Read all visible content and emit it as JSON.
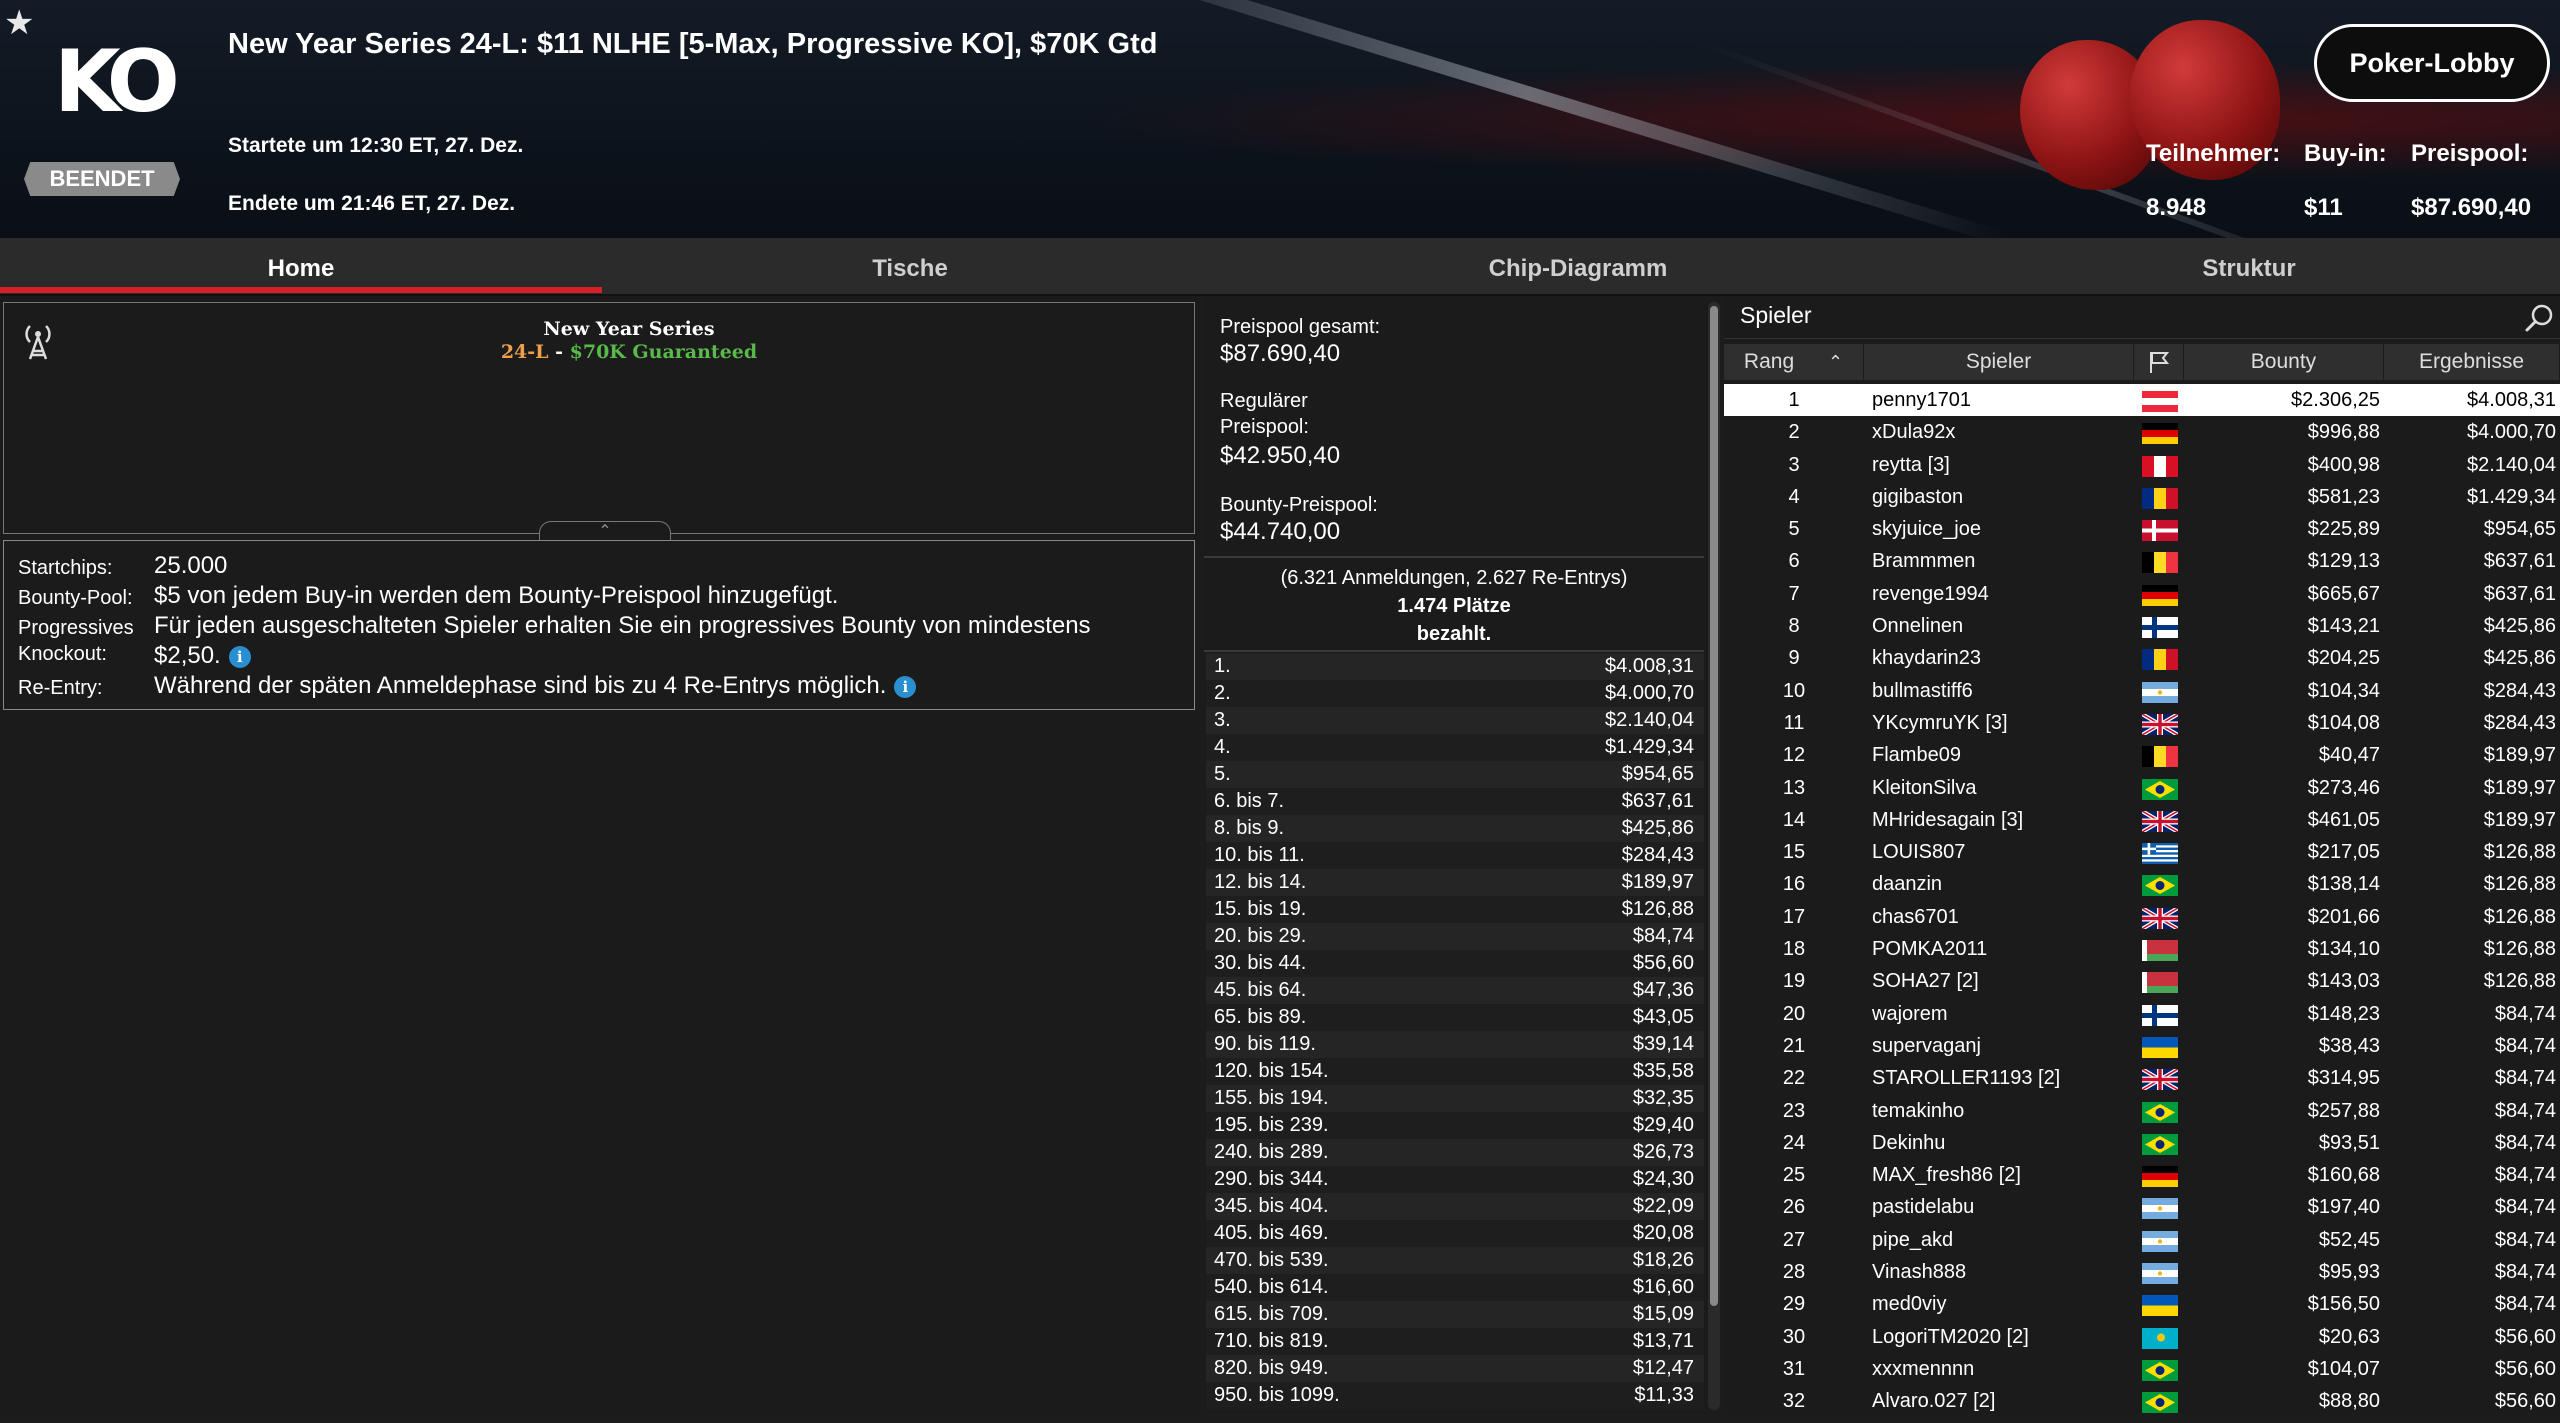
{
  "header": {
    "title": "New Year Series 24-L: $11 NLHE [5-Max, Progressive KO], $70K Gtd",
    "logo_text": "KO",
    "status_badge": "BEENDET",
    "started": "Startete um 12:30 ET, 27. Dez.",
    "ended": "Endete um 21:46 ET, 27. Dez.",
    "lobby_button": "Poker-Lobby",
    "stats": [
      {
        "label": "Teilnehmer:",
        "value": "8.948"
      },
      {
        "label": "Buy-in:",
        "value": "$11"
      },
      {
        "label": "Preispool:",
        "value": "$87.690,40"
      }
    ]
  },
  "tabs": [
    {
      "label": "Home",
      "active": true
    },
    {
      "label": "Tische",
      "active": false
    },
    {
      "label": "Chip-Diagramm",
      "active": false
    },
    {
      "label": "Struktur",
      "active": false
    }
  ],
  "series": {
    "title": "New Year Series",
    "code": "24-L",
    "separator": " - ",
    "guarantee": "$70K Guaranteed",
    "collapse_icon": "chevron-up-icon"
  },
  "info": {
    "startchips_label": "Startchips:",
    "startchips_value": "25.000",
    "bounty_label": "Bounty-Pool:",
    "bounty_value": "$5 von jedem Buy-in werden dem Bounty-Preispool hinzugefügt.",
    "pko_label_1": "Progressives",
    "pko_label_2": "Knockout:",
    "pko_value_1": "Für jeden ausgeschalteten Spieler erhalten Sie ein progressives Bounty von mindestens",
    "pko_value_2": "$2,50.",
    "reentry_label": "Re-Entry:",
    "reentry_value": "Während der späten Anmeldephase sind bis zu 4 Re-Entrys möglich.",
    "info_glyph": "i"
  },
  "prize": {
    "total_label": "Preispool gesamt:",
    "total_value": "$87.690,40",
    "regular_label_1": "Regulärer",
    "regular_label_2": "Preispool:",
    "regular_value": "$42.950,40",
    "bounty_label": "Bounty-Preispool:",
    "bounty_value": "$44.740,00",
    "entries_note": "(6.321 Anmeldungen, 2.627 Re-Entrys)",
    "places_paid_1": "1.474 Plätze",
    "places_paid_2": "bezahlt.",
    "payouts": [
      {
        "place": "1.",
        "amount": "$4.008,31"
      },
      {
        "place": "2.",
        "amount": "$4.000,70"
      },
      {
        "place": "3.",
        "amount": "$2.140,04"
      },
      {
        "place": "4.",
        "amount": "$1.429,34"
      },
      {
        "place": "5.",
        "amount": "$954,65"
      },
      {
        "place": "6. bis 7.",
        "amount": "$637,61"
      },
      {
        "place": "8. bis 9.",
        "amount": "$425,86"
      },
      {
        "place": "10. bis 11.",
        "amount": "$284,43"
      },
      {
        "place": "12. bis 14.",
        "amount": "$189,97"
      },
      {
        "place": "15. bis 19.",
        "amount": "$126,88"
      },
      {
        "place": "20. bis 29.",
        "amount": "$84,74"
      },
      {
        "place": "30. bis 44.",
        "amount": "$56,60"
      },
      {
        "place": "45. bis 64.",
        "amount": "$47,36"
      },
      {
        "place": "65. bis 89.",
        "amount": "$43,05"
      },
      {
        "place": "90. bis 119.",
        "amount": "$39,14"
      },
      {
        "place": "120. bis 154.",
        "amount": "$35,58"
      },
      {
        "place": "155. bis 194.",
        "amount": "$32,35"
      },
      {
        "place": "195. bis 239.",
        "amount": "$29,40"
      },
      {
        "place": "240. bis 289.",
        "amount": "$26,73"
      },
      {
        "place": "290. bis 344.",
        "amount": "$24,30"
      },
      {
        "place": "345. bis 404.",
        "amount": "$22,09"
      },
      {
        "place": "405. bis 469.",
        "amount": "$20,08"
      },
      {
        "place": "470. bis 539.",
        "amount": "$18,26"
      },
      {
        "place": "540. bis 614.",
        "amount": "$16,60"
      },
      {
        "place": "615. bis 709.",
        "amount": "$15,09"
      },
      {
        "place": "710. bis 819.",
        "amount": "$13,71"
      },
      {
        "place": "820. bis 949.",
        "amount": "$12,47"
      },
      {
        "place": "950. bis 1099.",
        "amount": "$11,33"
      }
    ]
  },
  "players": {
    "search_label": "Spieler",
    "columns": {
      "rank": "Rang",
      "player": "Spieler",
      "bounty": "Bounty",
      "result": "Ergebnisse"
    },
    "sort_icon": "caret-up-icon",
    "flag_header_icon": "flag-icon",
    "rows": [
      {
        "rank": "1",
        "name": "penny1701",
        "flag": "AT",
        "bounty": "$2.306,25",
        "result": "$4.008,31"
      },
      {
        "rank": "2",
        "name": "xDula92x",
        "flag": "DE",
        "bounty": "$996,88",
        "result": "$4.000,70"
      },
      {
        "rank": "3",
        "name": "reytta [3]",
        "flag": "PE",
        "bounty": "$400,98",
        "result": "$2.140,04"
      },
      {
        "rank": "4",
        "name": "gigibaston",
        "flag": "RO",
        "bounty": "$581,23",
        "result": "$1.429,34"
      },
      {
        "rank": "5",
        "name": "skyjuice_joe",
        "flag": "DK",
        "bounty": "$225,89",
        "result": "$954,65"
      },
      {
        "rank": "6",
        "name": "Brammmen",
        "flag": "BE",
        "bounty": "$129,13",
        "result": "$637,61"
      },
      {
        "rank": "7",
        "name": "revenge1994",
        "flag": "DE",
        "bounty": "$665,67",
        "result": "$637,61"
      },
      {
        "rank": "8",
        "name": "Onnelinen",
        "flag": "FI",
        "bounty": "$143,21",
        "result": "$425,86"
      },
      {
        "rank": "9",
        "name": "khaydarin23",
        "flag": "RO",
        "bounty": "$204,25",
        "result": "$425,86"
      },
      {
        "rank": "10",
        "name": "bullmastiff6",
        "flag": "AR",
        "bounty": "$104,34",
        "result": "$284,43"
      },
      {
        "rank": "11",
        "name": "YKcymruYK [3]",
        "flag": "GB",
        "bounty": "$104,08",
        "result": "$284,43"
      },
      {
        "rank": "12",
        "name": "Flambe09",
        "flag": "BE",
        "bounty": "$40,47",
        "result": "$189,97"
      },
      {
        "rank": "13",
        "name": "KleitonSilva",
        "flag": "BR",
        "bounty": "$273,46",
        "result": "$189,97"
      },
      {
        "rank": "14",
        "name": "MHridesagain [3]",
        "flag": "GB",
        "bounty": "$461,05",
        "result": "$189,97"
      },
      {
        "rank": "15",
        "name": "LOUIS807",
        "flag": "GR",
        "bounty": "$217,05",
        "result": "$126,88"
      },
      {
        "rank": "16",
        "name": "daanzin",
        "flag": "BR",
        "bounty": "$138,14",
        "result": "$126,88"
      },
      {
        "rank": "17",
        "name": "chas6701",
        "flag": "GB",
        "bounty": "$201,66",
        "result": "$126,88"
      },
      {
        "rank": "18",
        "name": "POMKA2011",
        "flag": "BY",
        "bounty": "$134,10",
        "result": "$126,88"
      },
      {
        "rank": "19",
        "name": "SOHA27 [2]",
        "flag": "BY",
        "bounty": "$143,03",
        "result": "$126,88"
      },
      {
        "rank": "20",
        "name": "wajorem",
        "flag": "FI",
        "bounty": "$148,23",
        "result": "$84,74"
      },
      {
        "rank": "21",
        "name": "supervaganj",
        "flag": "UA",
        "bounty": "$38,43",
        "result": "$84,74"
      },
      {
        "rank": "22",
        "name": "STAROLLER1193 [2]",
        "flag": "GB",
        "bounty": "$314,95",
        "result": "$84,74"
      },
      {
        "rank": "23",
        "name": "temakinho",
        "flag": "BR",
        "bounty": "$257,88",
        "result": "$84,74"
      },
      {
        "rank": "24",
        "name": "Dekinhu",
        "flag": "BR",
        "bounty": "$93,51",
        "result": "$84,74"
      },
      {
        "rank": "25",
        "name": "MAX_fresh86 [2]",
        "flag": "DE",
        "bounty": "$160,68",
        "result": "$84,74"
      },
      {
        "rank": "26",
        "name": "pastidelabu",
        "flag": "AR",
        "bounty": "$197,40",
        "result": "$84,74"
      },
      {
        "rank": "27",
        "name": "pipe_akd",
        "flag": "AR",
        "bounty": "$52,45",
        "result": "$84,74"
      },
      {
        "rank": "28",
        "name": "Vinash888",
        "flag": "AR",
        "bounty": "$95,93",
        "result": "$84,74"
      },
      {
        "rank": "29",
        "name": "med0viy",
        "flag": "UA",
        "bounty": "$156,50",
        "result": "$84,74"
      },
      {
        "rank": "30",
        "name": "LogoriTM2020 [2]",
        "flag": "KZ",
        "bounty": "$20,63",
        "result": "$56,60"
      },
      {
        "rank": "31",
        "name": "xxxmennnn",
        "flag": "BR",
        "bounty": "$104,07",
        "result": "$56,60"
      },
      {
        "rank": "32",
        "name": "Alvaro.027 [2]",
        "flag": "BR",
        "bounty": "$88,80",
        "result": "$56,60"
      }
    ]
  },
  "colors": {
    "accent_red": "#d61f26",
    "series_orange": "#f0a04b",
    "series_green": "#59b94a",
    "info_blue": "#2a8fd0"
  }
}
